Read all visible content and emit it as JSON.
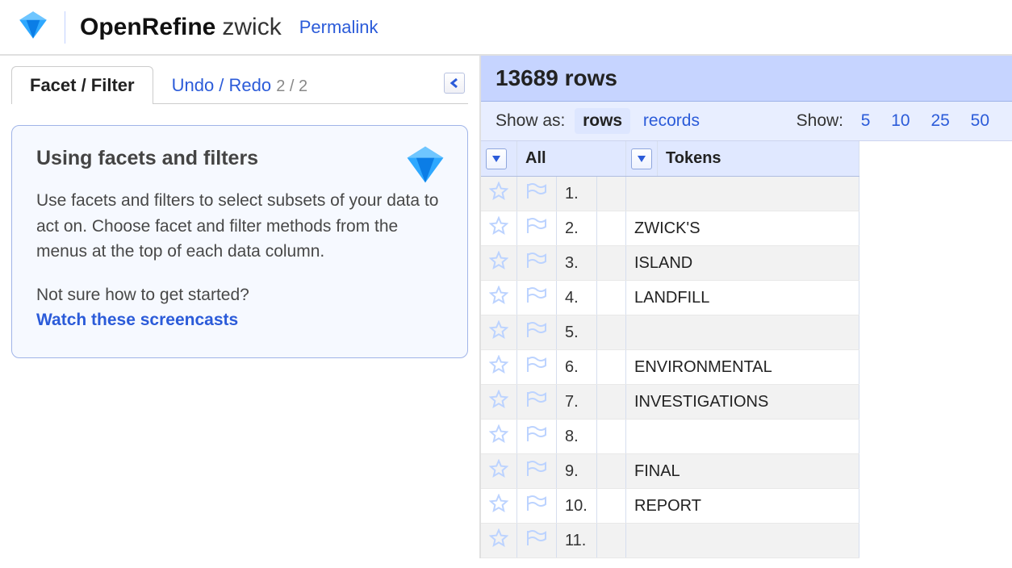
{
  "header": {
    "app_name": "OpenRefine",
    "project_name": "zwick",
    "permalink_label": "Permalink"
  },
  "tabs": {
    "facet_filter_label": "Facet / Filter",
    "undo_redo_label": "Undo / Redo",
    "undo_redo_count": "2 / 2"
  },
  "help": {
    "title": "Using facets and filters",
    "paragraph": "Use facets and filters to select subsets of your data to act on. Choose facet and filter methods from the menus at the top of each data column.",
    "hint": "Not sure how to get started?",
    "link_label": "Watch these screencasts"
  },
  "summary": {
    "rows_header": "13689 rows",
    "show_as_label": "Show as:",
    "show_as_options": {
      "rows": "rows",
      "records": "records"
    },
    "show_label": "Show:",
    "page_sizes": {
      "p5": "5",
      "p10": "10",
      "p25": "25",
      "p50": "50"
    }
  },
  "columns": {
    "all_label": "All",
    "tokens_label": "Tokens"
  },
  "rows": [
    {
      "idx": "1.",
      "token": ""
    },
    {
      "idx": "2.",
      "token": "ZWICK'S"
    },
    {
      "idx": "3.",
      "token": "ISLAND"
    },
    {
      "idx": "4.",
      "token": "LANDFILL"
    },
    {
      "idx": "5.",
      "token": ""
    },
    {
      "idx": "6.",
      "token": "ENVIRONMENTAL"
    },
    {
      "idx": "7.",
      "token": "INVESTIGATIONS"
    },
    {
      "idx": "8.",
      "token": ""
    },
    {
      "idx": "9.",
      "token": "FINAL"
    },
    {
      "idx": "10.",
      "token": "REPORT"
    },
    {
      "idx": "11.",
      "token": ""
    }
  ]
}
